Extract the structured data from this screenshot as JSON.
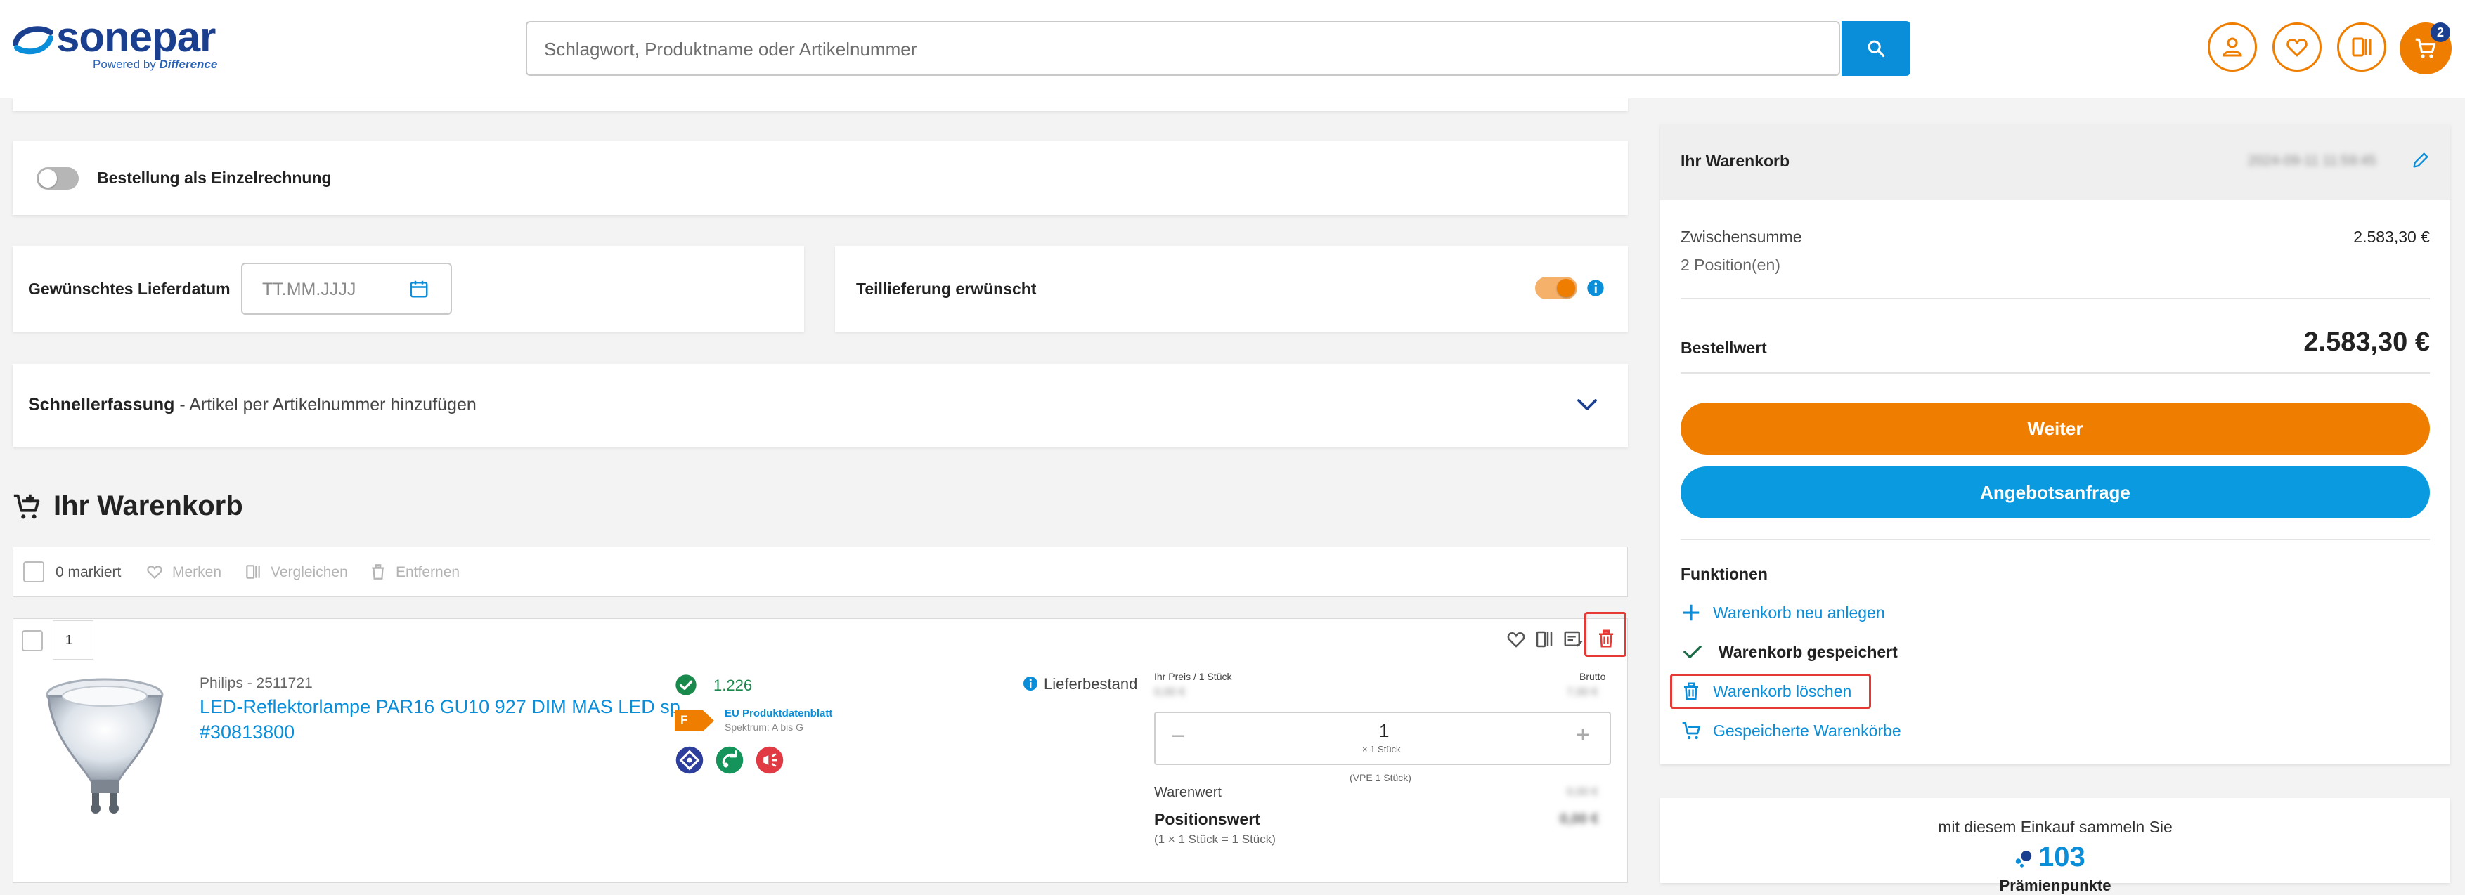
{
  "header": {
    "logo_text": "sonepar",
    "logo_tag_prefix": "Powered by ",
    "logo_tag_bold": "Difference",
    "search_placeholder": "Schlagwort, Produktname oder Artikelnummer",
    "cart_count": "2"
  },
  "options": {
    "single_invoice_label": "Bestellung als Einzelrechnung",
    "delivery_date_label": "Gewünschtes Lieferdatum",
    "delivery_date_placeholder": "TT.MM.JJJJ",
    "partial_delivery_label": "Teillieferung erwünscht",
    "quick_entry_bold": "Schnellerfassung",
    "quick_entry_rest": " - Artikel per Artikelnummer hinzufügen"
  },
  "cart": {
    "title": "Ihr Warenkorb",
    "toolbar": {
      "marked": "0 markiert",
      "remember": "Merken",
      "compare": "Vergleichen",
      "remove": "Entfernen"
    },
    "items": [
      {
        "position": "1",
        "brand": "Philips - 2511721",
        "name_line1": "LED-Reflektorlampe PAR16 GU10 927 DIM MAS LED sp",
        "name_line2": "#30813800",
        "stock": "1.226",
        "energy_class": "F",
        "eu_sheet": "EU Produktdatenblatt",
        "spectrum": "Spektrum: A bis G",
        "availability": "Lieferbestand",
        "price_label": "Ihr Preis / 1 Stück",
        "price_value": "0,00 €",
        "gross_label": "Brutto",
        "gross_value": "7,00 €",
        "qty": "1",
        "qty_unit": "× 1 Stück",
        "vpe": "(VPE 1 Stück)",
        "goods_value_label": "Warenwert",
        "goods_value": "0,00 €",
        "position_value_label": "Positionswert",
        "position_value_note": "(1 × 1 Stück = 1 Stück)",
        "position_value": "0,00 €"
      }
    ]
  },
  "summary": {
    "title": "Ihr Warenkorb",
    "timestamp": "2024-09-11 11:59:45",
    "subtotal_label": "Zwischensumme",
    "subtotal_value": "2.583,30 €",
    "positions": "2 Position(en)",
    "order_value_label": "Bestellwert",
    "order_value": "2.583,30 €",
    "continue_label": "Weiter",
    "quote_label": "Angebotsanfrage",
    "functions_title": "Funktionen",
    "functions": [
      {
        "label": "Warenkorb neu anlegen",
        "icon": "plus-icon"
      },
      {
        "label": "Warenkorb gespeichert",
        "icon": "check-icon"
      },
      {
        "label": "Warenkorb löschen",
        "icon": "trash-icon"
      },
      {
        "label": "Gespeicherte Warenkörbe",
        "icon": "cart-icon"
      }
    ]
  },
  "points": {
    "text": "mit diesem Einkauf sammeln Sie",
    "value": "103",
    "sub": "Prämienpunkte"
  },
  "colors": {
    "accent_orange": "#ef7d00",
    "accent_blue": "#0a8ed9",
    "brand_navy": "#1b3f8f",
    "highlight_red": "#e53935"
  }
}
